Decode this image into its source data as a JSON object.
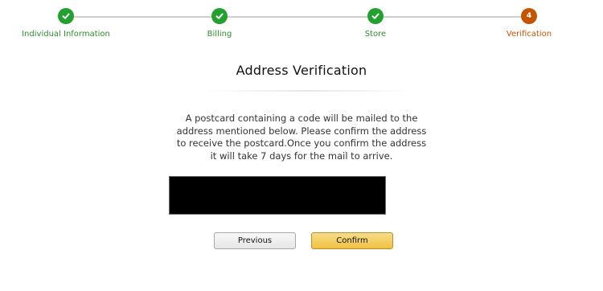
{
  "stepper": {
    "steps": [
      {
        "label": "Individual Information",
        "state": "done"
      },
      {
        "label": "Billing",
        "state": "done"
      },
      {
        "label": "Store",
        "state": "done"
      },
      {
        "label": "Verification",
        "state": "current",
        "number": "4"
      }
    ],
    "colors": {
      "done": "#23a02f",
      "current": "#c45500",
      "line": "#cfcfcf"
    }
  },
  "main": {
    "title": "Address Verification",
    "message": "A postcard containing a code will be mailed to the address mentioned below. Please confirm the address to receive the postcard.Once you confirm the address it will take 7 days for the mail to arrive."
  },
  "actions": {
    "previous_label": "Previous",
    "confirm_label": "Confirm"
  }
}
